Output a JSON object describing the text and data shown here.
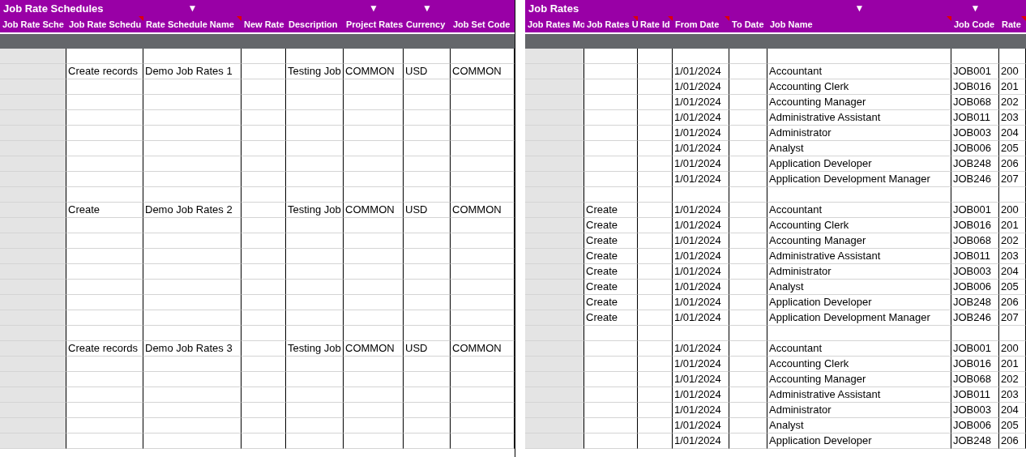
{
  "panels": [
    {
      "title": "Job Rate Schedules",
      "columns": [
        {
          "label": "Job Rate Sche",
          "comment": false
        },
        {
          "label": "Job Rate Schedu",
          "comment": true
        },
        {
          "label": "Rate Schedule Name",
          "comment": true,
          "filter": "▼"
        },
        {
          "label": "New Rate",
          "comment": false
        },
        {
          "label": "Description",
          "comment": false
        },
        {
          "label": "Project Rates",
          "comment": false,
          "filter": "▼"
        },
        {
          "label": "Currency",
          "comment": false,
          "filter": "▼"
        },
        {
          "label": "Job Set Code",
          "comment": false
        }
      ],
      "rows": [
        {},
        {
          "1": "Create records",
          "2": "Demo Job Rates 1",
          "4": "Testing Job",
          "5": "COMMON",
          "6": "USD",
          "7": "COMMON"
        },
        {},
        {},
        {},
        {},
        {},
        {},
        {},
        {},
        {
          "1": "Create",
          "2": "Demo Job Rates 2",
          "4": "Testing Job",
          "5": "COMMON",
          "6": "USD",
          "7": "COMMON"
        },
        {},
        {},
        {},
        {},
        {},
        {},
        {},
        {},
        {
          "1": "Create records",
          "2": "Demo Job Rates 3",
          "4": "Testing Job",
          "5": "COMMON",
          "6": "USD",
          "7": "COMMON"
        },
        {},
        {},
        {},
        {},
        {},
        {}
      ]
    },
    {
      "title": "Job Rates",
      "columns": [
        {
          "label": "Job Rates Mo",
          "comment": false
        },
        {
          "label": "Job Rates U",
          "comment": true
        },
        {
          "label": "Rate Id",
          "comment": true
        },
        {
          "label": "From Date",
          "comment": true
        },
        {
          "label": "To Date",
          "comment": false
        },
        {
          "label": "Job Name",
          "comment": true,
          "filter": "▼"
        },
        {
          "label": "Job Code",
          "comment": false,
          "filter": "▼"
        },
        {
          "label": "Rate",
          "comment": true
        }
      ],
      "rows": [
        {},
        {
          "3": "1/01/2024",
          "5": "Accountant",
          "6": "JOB001",
          "7": "200"
        },
        {
          "3": "1/01/2024",
          "5": "Accounting Clerk",
          "6": "JOB016",
          "7": "201"
        },
        {
          "3": "1/01/2024",
          "5": "Accounting Manager",
          "6": "JOB068",
          "7": "202"
        },
        {
          "3": "1/01/2024",
          "5": "Administrative Assistant",
          "6": "JOB011",
          "7": "203"
        },
        {
          "3": "1/01/2024",
          "5": "Administrator",
          "6": "JOB003",
          "7": "204"
        },
        {
          "3": "1/01/2024",
          "5": "Analyst",
          "6": "JOB006",
          "7": "205"
        },
        {
          "3": "1/01/2024",
          "5": "Application Developer",
          "6": "JOB248",
          "7": "206"
        },
        {
          "3": "1/01/2024",
          "5": "Application Development Manager",
          "6": "JOB246",
          "7": "207"
        },
        {},
        {
          "1": "Create",
          "3": "1/01/2024",
          "5": "Accountant",
          "6": "JOB001",
          "7": "200"
        },
        {
          "1": "Create",
          "3": "1/01/2024",
          "5": "Accounting Clerk",
          "6": "JOB016",
          "7": "201"
        },
        {
          "1": "Create",
          "3": "1/01/2024",
          "5": "Accounting Manager",
          "6": "JOB068",
          "7": "202"
        },
        {
          "1": "Create",
          "3": "1/01/2024",
          "5": "Administrative Assistant",
          "6": "JOB011",
          "7": "203"
        },
        {
          "1": "Create",
          "3": "1/01/2024",
          "5": "Administrator",
          "6": "JOB003",
          "7": "204"
        },
        {
          "1": "Create",
          "3": "1/01/2024",
          "5": "Analyst",
          "6": "JOB006",
          "7": "205"
        },
        {
          "1": "Create",
          "3": "1/01/2024",
          "5": "Application Developer",
          "6": "JOB248",
          "7": "206"
        },
        {
          "1": "Create",
          "3": "1/01/2024",
          "5": "Application Development Manager",
          "6": "JOB246",
          "7": "207"
        },
        {},
        {
          "3": "1/01/2024",
          "5": "Accountant",
          "6": "JOB001",
          "7": "200"
        },
        {
          "3": "1/01/2024",
          "5": "Accounting Clerk",
          "6": "JOB016",
          "7": "201"
        },
        {
          "3": "1/01/2024",
          "5": "Accounting Manager",
          "6": "JOB068",
          "7": "202"
        },
        {
          "3": "1/01/2024",
          "5": "Administrative Assistant",
          "6": "JOB011",
          "7": "203"
        },
        {
          "3": "1/01/2024",
          "5": "Administrator",
          "6": "JOB003",
          "7": "204"
        },
        {
          "3": "1/01/2024",
          "5": "Analyst",
          "6": "JOB006",
          "7": "205"
        },
        {
          "3": "1/01/2024",
          "5": "Application Developer",
          "6": "JOB248",
          "7": "206"
        }
      ]
    }
  ]
}
